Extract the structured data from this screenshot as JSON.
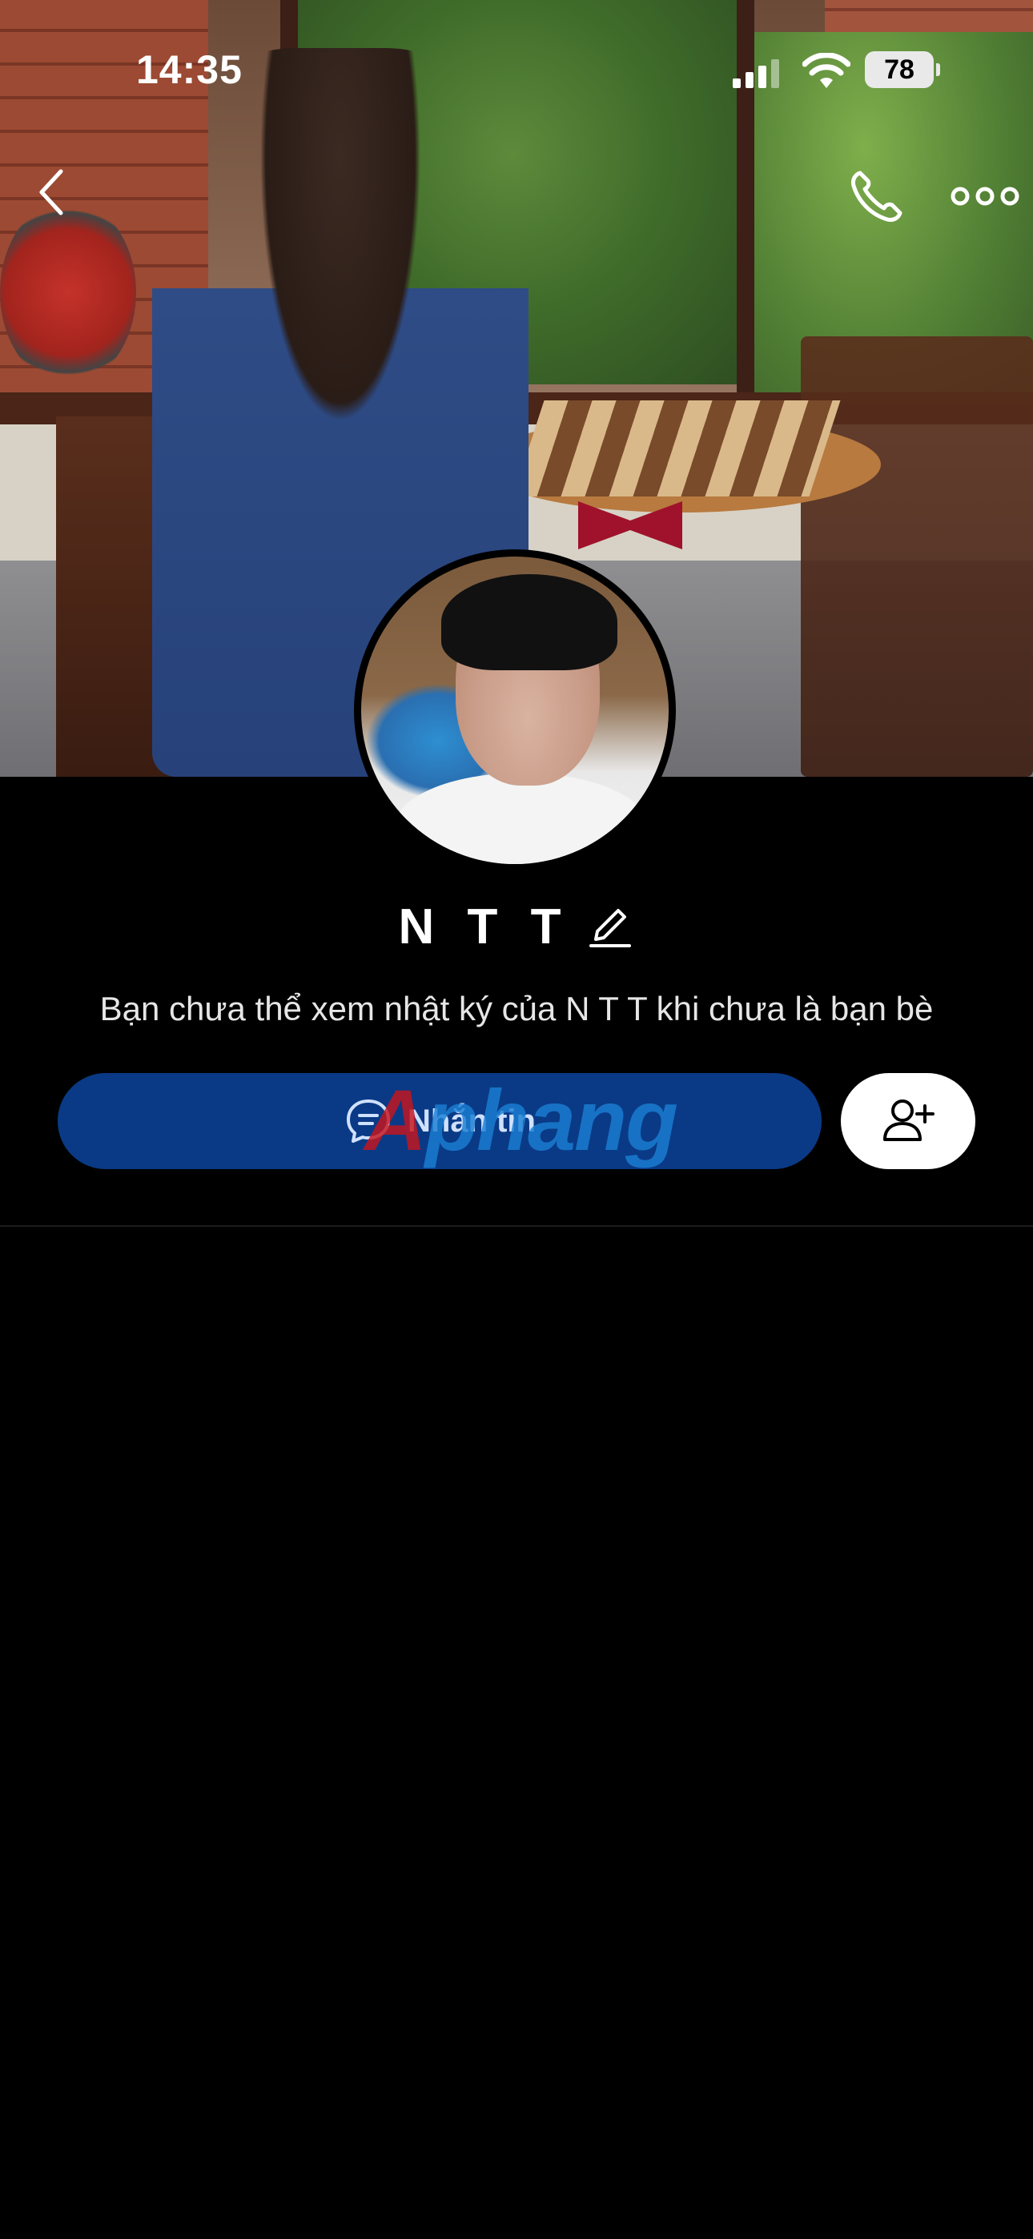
{
  "status_bar": {
    "time": "14:35",
    "battery": "78"
  },
  "nav": {
    "back_icon": "chevron-left-icon",
    "call_icon": "phone-icon",
    "more_icon": "more-horizontal-icon"
  },
  "profile": {
    "name": "N T T",
    "edit_icon": "pencil-icon",
    "privacy_notice": "Bạn chưa thể xem nhật ký của N T T khi chưa là bạn bè"
  },
  "actions": {
    "message_label": "Nhắn tin",
    "message_icon": "chat-bubble-icon",
    "add_friend_icon": "user-plus-icon"
  },
  "watermark": {
    "part1": "A",
    "part2": "phang"
  },
  "colors": {
    "primary_button": "#0a3a86",
    "background": "#000000"
  }
}
